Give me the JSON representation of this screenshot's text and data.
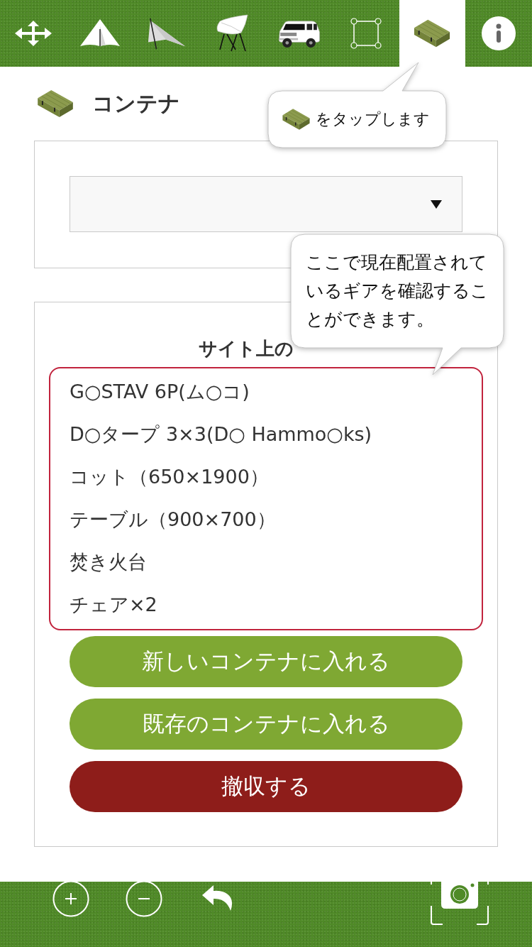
{
  "toolbar": {
    "tabs": [
      {
        "kind": "move",
        "selected": false
      },
      {
        "kind": "tent",
        "selected": false
      },
      {
        "kind": "tarp",
        "selected": false
      },
      {
        "kind": "chair",
        "selected": false
      },
      {
        "kind": "car",
        "selected": false
      },
      {
        "kind": "area",
        "selected": false
      },
      {
        "kind": "container",
        "selected": true
      },
      {
        "kind": "info",
        "selected": false
      }
    ]
  },
  "header": {
    "title": "コンテナ"
  },
  "gear_panel": {
    "title": "サイト上の",
    "items": [
      "G○STAV 6P(ム○コ)",
      "D○タープ 3×3(D○ Hammo○ks)",
      "コット（650×1900）",
      "テーブル（900×700）",
      "焚き火台",
      "チェア×2"
    ]
  },
  "buttons": [
    {
      "kind": "primary",
      "label": "新しいコンテナに入れる"
    },
    {
      "kind": "primary",
      "label": "既存のコンテナに入れる"
    },
    {
      "kind": "danger",
      "label": "撤収する"
    }
  ],
  "tooltips": [
    {
      "kind": "tap_hint",
      "text": "をタップします"
    },
    {
      "kind": "info",
      "text": "ここで現在配置されているギアを確認することができます。"
    }
  ],
  "bottom_bar": {
    "buttons": [
      {
        "kind": "zoom_in"
      },
      {
        "kind": "zoom_out"
      },
      {
        "kind": "undo"
      },
      {
        "kind": "camera"
      }
    ]
  }
}
